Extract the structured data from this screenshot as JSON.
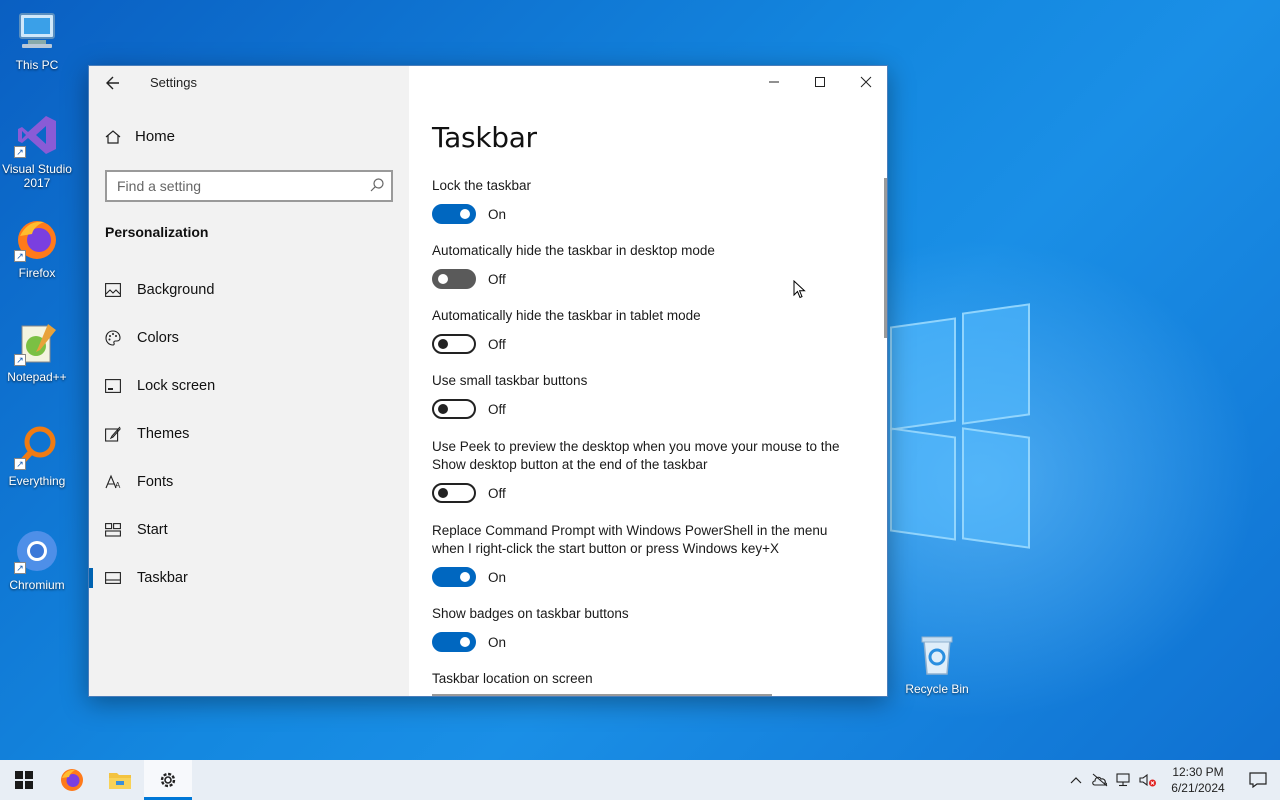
{
  "desktop": {
    "icons": [
      {
        "label": "This PC"
      },
      {
        "label": "Visual Studio 2017"
      },
      {
        "label": "Firefox"
      },
      {
        "label": "Notepad++"
      },
      {
        "label": "Everything"
      },
      {
        "label": "Chromium"
      },
      {
        "label": "Recycle Bin"
      }
    ]
  },
  "window": {
    "title": "Settings",
    "back_icon": "arrow-left-icon",
    "caption": [
      "minimize-icon",
      "maximize-icon",
      "close-icon"
    ]
  },
  "sidebar": {
    "home_label": "Home",
    "search_placeholder": "Find a setting",
    "section_heading": "Personalization",
    "items": [
      {
        "label": "Background",
        "icon": "picture-icon"
      },
      {
        "label": "Colors",
        "icon": "palette-icon"
      },
      {
        "label": "Lock screen",
        "icon": "lock-screen-icon"
      },
      {
        "label": "Themes",
        "icon": "brush-icon"
      },
      {
        "label": "Fonts",
        "icon": "font-icon"
      },
      {
        "label": "Start",
        "icon": "start-tiles-icon"
      },
      {
        "label": "Taskbar",
        "icon": "taskbar-icon",
        "selected": true
      }
    ]
  },
  "main": {
    "title": "Taskbar",
    "settings": [
      {
        "label": "Lock the taskbar",
        "state": "On"
      },
      {
        "label": "Automatically hide the taskbar in desktop mode",
        "state": "Off"
      },
      {
        "label": "Automatically hide the taskbar in tablet mode",
        "state": "Off"
      },
      {
        "label": "Use small taskbar buttons",
        "state": "Off"
      },
      {
        "label": "Use Peek to preview the desktop when you move your mouse to the Show desktop button at the end of the taskbar",
        "state": "Off"
      },
      {
        "label": "Replace Command Prompt with Windows PowerShell in the menu when I right-click the start button or press Windows key+X",
        "state": "On"
      },
      {
        "label": "Show badges on taskbar buttons",
        "state": "On"
      }
    ],
    "location_label": "Taskbar location on screen"
  },
  "taskbar": {
    "pinned": [
      "windows-start-icon",
      "firefox-icon",
      "file-explorer-icon",
      "settings-gear-icon"
    ],
    "active": "settings-gear-icon",
    "tray_icons": [
      "chevron-up-icon",
      "onedrive-offline-icon",
      "network-icon",
      "volume-muted-icon"
    ],
    "time": "12:30 PM",
    "date": "6/21/2024",
    "notification_icon": "action-center-icon"
  },
  "colors": {
    "accent": "#0067c0",
    "sidebar_bg": "#f2f2f2",
    "taskbar_bg": "#e8eef5"
  }
}
